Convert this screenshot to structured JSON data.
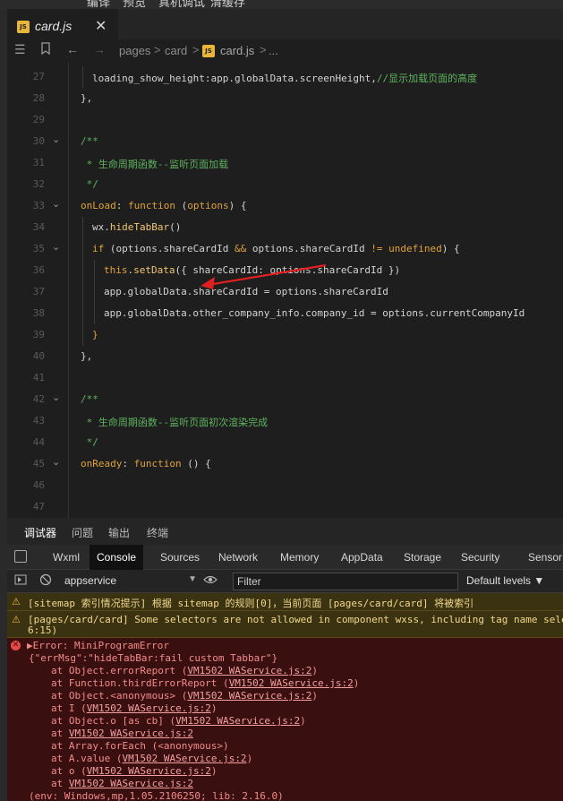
{
  "menu": [
    "编译",
    "预览",
    "真机调试",
    "清缓存"
  ],
  "tab": {
    "badge": "JS",
    "title": "card.js",
    "close": "✕"
  },
  "breadcrumb": {
    "items": [
      "pages",
      "card",
      "card.js",
      "..."
    ],
    "separator": ">"
  },
  "editor": {
    "lines": [
      {
        "n": "27",
        "fold": "",
        "indent": 1,
        "tokens": [
          [
            "var",
            "loading_show_height:app.globalData.screenHeight,"
          ],
          [
            "cmt",
            "//显示加载页面的高度"
          ]
        ]
      },
      {
        "n": "28",
        "fold": "",
        "indent": 0,
        "tokens": [
          [
            "var",
            "},"
          ]
        ]
      },
      {
        "n": "29",
        "fold": "",
        "indent": 0,
        "tokens": []
      },
      {
        "n": "30",
        "fold": "⌄",
        "indent": 0,
        "tokens": [
          [
            "cmt",
            "/**"
          ]
        ]
      },
      {
        "n": "31",
        "fold": "",
        "indent": 0,
        "tokens": [
          [
            "cmt",
            " * 生命周期函数--监听页面加载"
          ]
        ]
      },
      {
        "n": "32",
        "fold": "",
        "indent": 0,
        "tokens": [
          [
            "cmt",
            " */"
          ]
        ]
      },
      {
        "n": "33",
        "fold": "⌄",
        "indent": 0,
        "tokens": [
          [
            "prop",
            "onLoad"
          ],
          [
            "var",
            ": "
          ],
          [
            "kw",
            "function"
          ],
          [
            "var",
            " ("
          ],
          [
            "kw",
            "options"
          ],
          [
            "var",
            ") {"
          ]
        ]
      },
      {
        "n": "34",
        "fold": "",
        "indent": 1,
        "tokens": [
          [
            "var",
            "wx."
          ],
          [
            "fn",
            "hideTabBar"
          ],
          [
            "var",
            "()"
          ]
        ]
      },
      {
        "n": "35",
        "fold": "⌄",
        "indent": 1,
        "tokens": [
          [
            "kw",
            "if"
          ],
          [
            "var",
            " (options.shareCardId "
          ],
          [
            "kw",
            "&&"
          ],
          [
            "var",
            " options.shareCardId "
          ],
          [
            "kw",
            "!="
          ],
          [
            "var",
            " "
          ],
          [
            "kw",
            "undefined"
          ],
          [
            "var",
            ") {"
          ]
        ]
      },
      {
        "n": "36",
        "fold": "",
        "indent": 2,
        "tokens": [
          [
            "kw",
            "this"
          ],
          [
            "var",
            "."
          ],
          [
            "fn",
            "setData"
          ],
          [
            "var",
            "({ shareCardId: options.shareCardId })"
          ]
        ]
      },
      {
        "n": "37",
        "fold": "",
        "indent": 2,
        "tokens": [
          [
            "var",
            "app.globalData.shareCardId = options.shareCardId"
          ]
        ]
      },
      {
        "n": "38",
        "fold": "",
        "indent": 2,
        "tokens": [
          [
            "var",
            "app.globalData.other_company_info.company_id = options.currentCompanyId"
          ]
        ]
      },
      {
        "n": "39",
        "fold": "",
        "indent": 1,
        "tokens": [
          [
            "kw",
            "}"
          ]
        ]
      },
      {
        "n": "40",
        "fold": "",
        "indent": 0,
        "tokens": [
          [
            "var",
            "},"
          ]
        ]
      },
      {
        "n": "41",
        "fold": "",
        "indent": 0,
        "tokens": []
      },
      {
        "n": "42",
        "fold": "⌄",
        "indent": 0,
        "tokens": [
          [
            "cmt",
            "/**"
          ]
        ]
      },
      {
        "n": "43",
        "fold": "",
        "indent": 0,
        "tokens": [
          [
            "cmt",
            " * 生命周期函数--监听页面初次渲染完成"
          ]
        ]
      },
      {
        "n": "44",
        "fold": "",
        "indent": 0,
        "tokens": [
          [
            "cmt",
            " */"
          ]
        ]
      },
      {
        "n": "45",
        "fold": "⌄",
        "indent": 0,
        "tokens": [
          [
            "prop",
            "onReady"
          ],
          [
            "var",
            ": "
          ],
          [
            "kw",
            "function"
          ],
          [
            "var",
            " () {"
          ]
        ]
      },
      {
        "n": "46",
        "fold": "",
        "indent": 0,
        "tokens": []
      },
      {
        "n": "47",
        "fold": "",
        "indent": 0,
        "tokens": []
      },
      {
        "n": "48",
        "fold": "",
        "indent": 0,
        "tokens": [
          [
            "var",
            "},"
          ]
        ]
      }
    ]
  },
  "devtools": {
    "tabs": [
      "调试器",
      "问题",
      "输出",
      "终端"
    ],
    "active_tab": "调试器",
    "panels": [
      "Wxml",
      "Console",
      "Sources",
      "Network",
      "Memory",
      "AppData",
      "Storage",
      "Security",
      "Sensor"
    ],
    "active_panel": "Console",
    "context": "appservice",
    "filter_placeholder": "Filter",
    "levels": "Default levels ▼"
  },
  "console": {
    "warnings": [
      {
        "text": "[sitemap 索引情况提示] 根据 sitemap 的规则[0]，当前页面 [pages/card/card] 将被索引"
      },
      {
        "text": "[pages/card/card] Some selectors are not allowed in component wxss, including tag name sele",
        "text2": "6:15)"
      }
    ],
    "error": {
      "title": "▶Error: MiniProgramError",
      "message": "{\"errMsg\":\"hideTabBar:fail custom Tabbar\"}",
      "frames": [
        {
          "at": "at Object.errorReport (",
          "loc": "VM1502 WAService.js:2",
          "end": ")"
        },
        {
          "at": "at Function.thirdErrorReport (",
          "loc": "VM1502 WAService.js:2",
          "end": ")"
        },
        {
          "at": "at Object.<anonymous> (",
          "loc": "VM1502 WAService.js:2",
          "end": ")"
        },
        {
          "at": "at I (",
          "loc": "VM1502 WAService.js:2",
          "end": ")"
        },
        {
          "at": "at Object.o [as cb] (",
          "loc": "VM1502 WAService.js:2",
          "end": ")"
        },
        {
          "at": "at ",
          "loc": "VM1502 WAService.js:2",
          "end": ""
        },
        {
          "at": "at Array.forEach (<anonymous>)",
          "loc": "",
          "end": ""
        },
        {
          "at": "at A.value (",
          "loc": "VM1502 WAService.js:2",
          "end": ")"
        },
        {
          "at": "at o (",
          "loc": "VM1502 WAService.js:2",
          "end": ")"
        },
        {
          "at": "at ",
          "loc": "VM1502 WAService.js:2",
          "end": ""
        }
      ],
      "env": "(env: Windows,mp,1.05.2106250; lib: 2.16.0)"
    }
  },
  "colors": {
    "accent": "#3794ff",
    "warning_bg": "#3b3212",
    "error_bg": "#3a0f10",
    "arrow": "#e02020"
  }
}
